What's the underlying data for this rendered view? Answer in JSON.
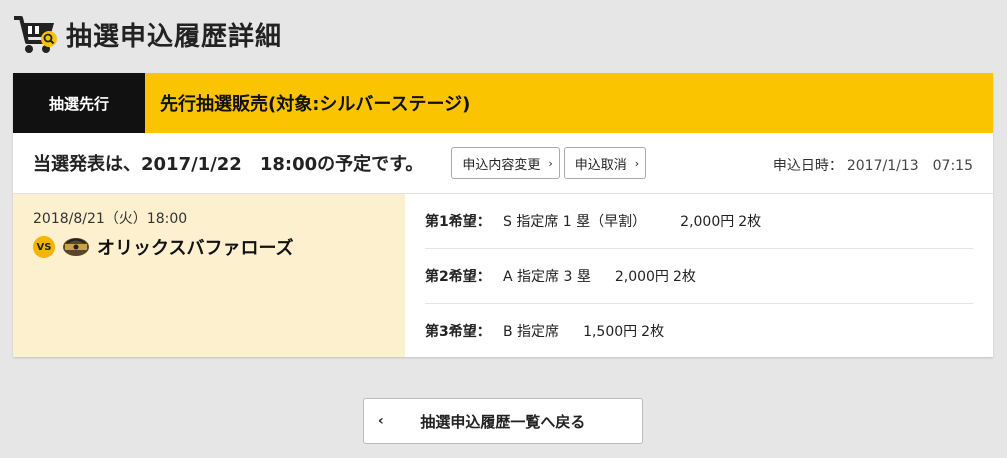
{
  "header": {
    "title": "抽選申込履歴詳細",
    "icon": "cart-search-icon"
  },
  "card": {
    "badge": "抽選先行",
    "sale_title": "先行抽選販売(対象:シルバーステージ)",
    "announcement": "当選発表は、2017/1/22　18:00の予定です。",
    "buttons": {
      "change": "申込内容変更",
      "cancel": "申込取消"
    },
    "apply_date": {
      "label": "申込日時：",
      "value": "2017/1/13　07:15"
    },
    "game": {
      "datetime": "2018/8/21（火）18:00",
      "vs": "VS",
      "opponent": "オリックスバファローズ"
    },
    "choices": [
      {
        "label": "第1希望：",
        "seat": "S 指定席 1 塁（早割）",
        "price": "2,000円",
        "qty": "2枚"
      },
      {
        "label": "第2希望：",
        "seat": "A 指定席 3 塁",
        "price": "2,000円",
        "qty": "2枚"
      },
      {
        "label": "第3希望：",
        "seat": "B 指定席",
        "price": "1,500円",
        "qty": "2枚"
      }
    ]
  },
  "back_button": {
    "label": "抽選申込履歴一覧へ戻る",
    "chevron": "‹"
  },
  "colors": {
    "accent": "#fac400",
    "dark": "#111111",
    "game_bg": "#fdf0cf"
  }
}
